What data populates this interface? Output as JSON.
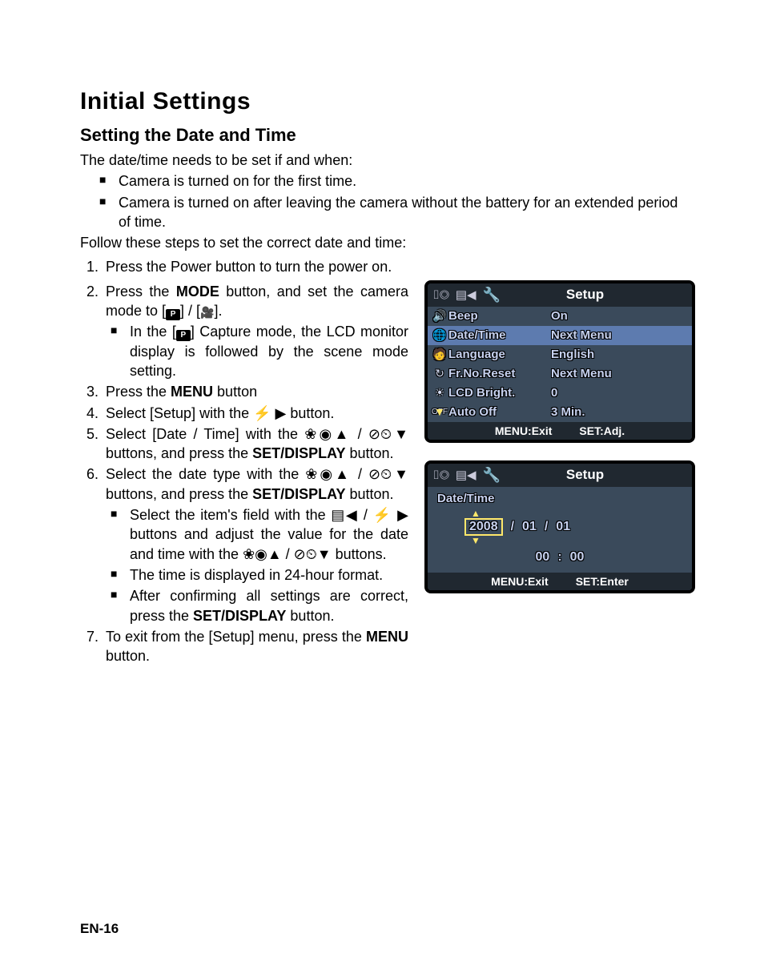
{
  "title": "Initial Settings",
  "subtitle": "Setting the Date and Time",
  "intro": "The date/time needs to be set if and when:",
  "intro_bullets": [
    "Camera is turned on for the first time.",
    "Camera is turned on after leaving the camera without the battery for an extended period of time."
  ],
  "follow": "Follow these steps to set the correct date and time:",
  "step1": "Press the Power button to turn the power on.",
  "step2a": "Press the ",
  "step2b": "MODE",
  "step2c": " button, and set the camera mode to [",
  "step2d": "] / [",
  "step2e": "].",
  "step2_inner_a": "In the [",
  "step2_inner_b": "] Capture mode, the LCD monitor display is followed by the scene mode setting.",
  "step3a": "Press the ",
  "step3b": "MENU",
  "step3c": " button",
  "step4": "Select [Setup] with the  ⚡ ▶ button.",
  "step5a": "Select [Date / Time] with the ",
  "step5b": " buttons, and press the ",
  "step5c": "SET/DISPLAY",
  "step5d": " button.",
  "step6a": "Select the date type with the ",
  "step6b": " buttons, and press the ",
  "step6c": "SET/DISPLAY",
  "step6d": " button.",
  "step6_i1a": "Select the item's field with the ",
  "step6_i1b": " buttons and adjust the value for the date and time with the ",
  "step6_i1c": " buttons.",
  "step6_i2": "The time is displayed in 24-hour format.",
  "step6_i3a": "After confirming all settings are correct, press the ",
  "step6_i3b": "SET/DISPLAY",
  "step6_i3c": " button.",
  "step7a": "To exit from the [Setup] menu, press the ",
  "step7b": "MENU",
  "step7c": " button.",
  "glyphs_updown": "❀◉▲ / ⊘⏲▼",
  "glyphs_leftright": "▤◀ / ⚡ ▶",
  "lcd1": {
    "header": "Setup",
    "rows": [
      {
        "icon": "🔊",
        "label": "Beep",
        "val": "On"
      },
      {
        "icon": "🌐",
        "label": "Date/Time",
        "val": "Next Menu"
      },
      {
        "icon": "🧑",
        "label": "Language",
        "val": "English"
      },
      {
        "icon": "↻",
        "label": "Fr.No.Reset",
        "val": "Next Menu"
      },
      {
        "icon": "☀",
        "label": "LCD Bright.",
        "val": "0"
      },
      {
        "icon": "OFF",
        "label": "Auto Off",
        "val": "3 Min."
      }
    ],
    "footer_left": "MENU:Exit",
    "footer_right": "SET:Adj."
  },
  "lcd2": {
    "header": "Setup",
    "label": "Date/Time",
    "year": "2008",
    "month": "01",
    "day": "01",
    "hour": "00",
    "minute": "00",
    "footer_left": "MENU:Exit",
    "footer_right": "SET:Enter"
  },
  "page_footer": "EN-16"
}
